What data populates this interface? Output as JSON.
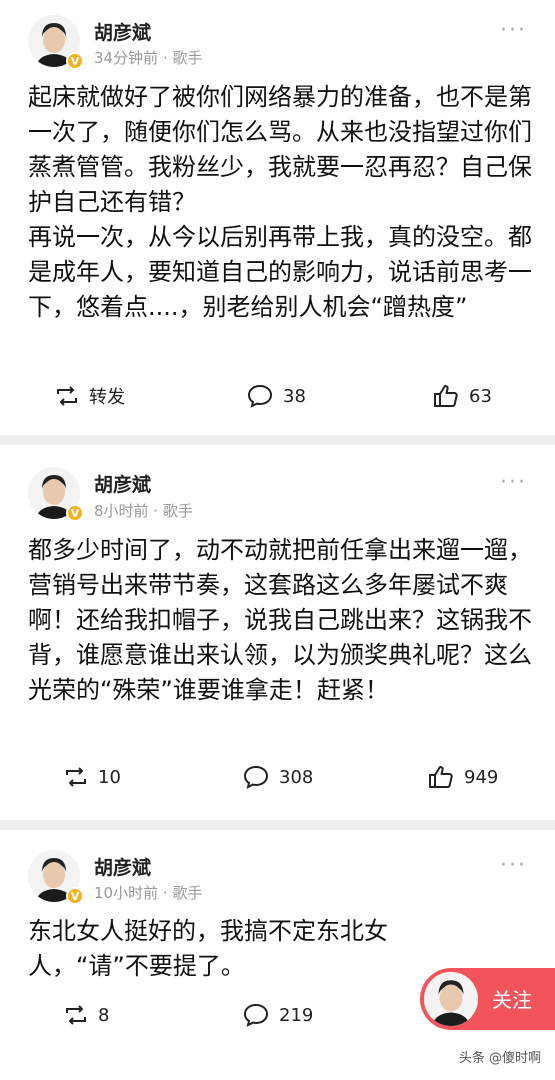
{
  "posts": [
    {
      "author": "胡彦斌",
      "meta": "34分钟前 · 歌手",
      "content": [
        "起床就做好了被你们网络暴力的准备，也不是第一次了，随便你们怎么骂。从来也没指望过你们蒸煮管管。我粉丝少，我就要一忍再忍？自己保护自己还有错？",
        "再说一次，从今以后别再带上我，真的没空。都是成年人，要知道自己的影响力，说话前思考一下，悠着点....，别老给别人机会“蹭热度”"
      ],
      "repost": "转发",
      "comments": "38",
      "likes": "63"
    },
    {
      "author": "胡彦斌",
      "meta": "8小时前 · 歌手",
      "content": [
        "都多少时间了，动不动就把前任拿出来遛一遛，营销号出来带节奏，这套路这么多年屡试不爽啊！还给我扣帽子，说我自己跳出来？这锅我不背，谁愿意谁出来认领，以为颁奖典礼呢？这么光荣的“殊荣”谁要谁拿走！赶紧！"
      ],
      "repost": "10",
      "comments": "308",
      "likes": "949"
    },
    {
      "author": "胡彦斌",
      "meta": "10小时前 · 歌手",
      "content": [
        "东北女人挺好的，我搞不定东北女人，“请”不要提了。"
      ],
      "repost": "8",
      "comments": "219",
      "likes": ""
    }
  ],
  "follow_label": "关注",
  "source_label": "头条 @傻时啊",
  "colors": {
    "accent": "#f2545b",
    "badge": "#f3b21c"
  }
}
